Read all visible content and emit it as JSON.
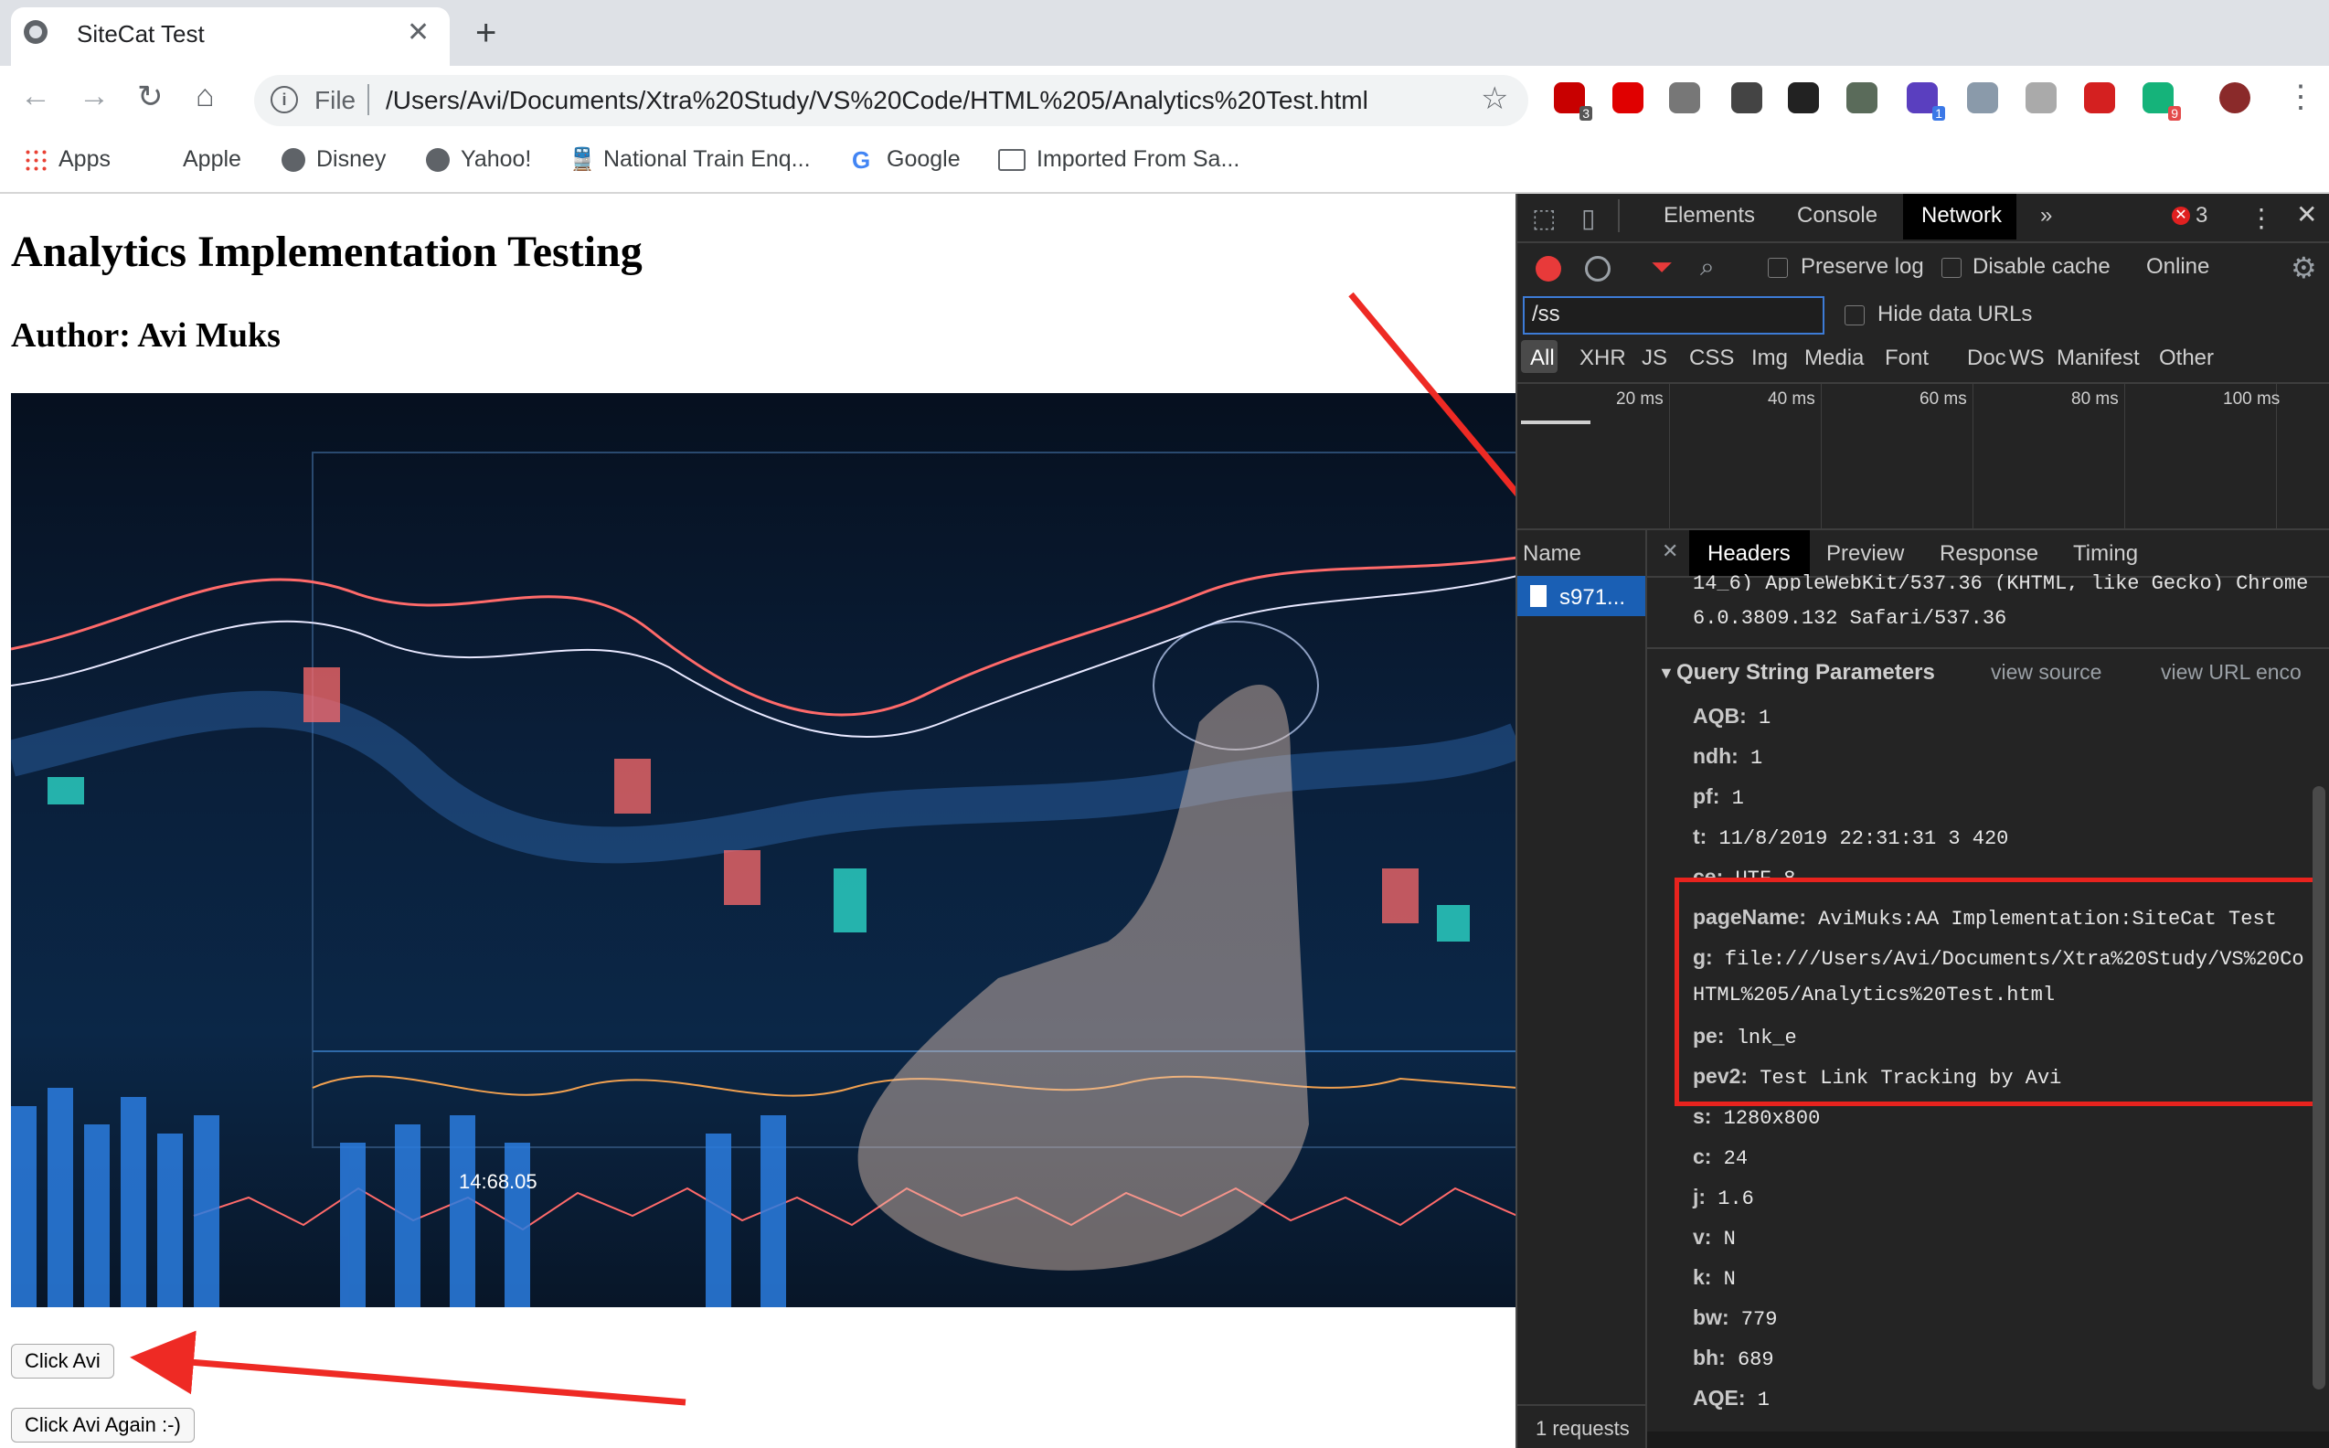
{
  "browser": {
    "tab_title": "SiteCat Test",
    "url_scheme": "File",
    "url": "/Users/Avi/Documents/Xtra%20Study/VS%20Code/HTML%205/Analytics%20Test.html"
  },
  "extensions": [
    {
      "name": "abp-icon",
      "color": "#c80000",
      "badge": "3"
    },
    {
      "name": "ublock-icon",
      "color": "#e00000",
      "badge": ""
    },
    {
      "name": "circle-icon",
      "color": "#777777",
      "badge": ""
    },
    {
      "name": "eye-icon",
      "color": "#444444",
      "badge": ""
    },
    {
      "name": "mask-icon",
      "color": "#222222",
      "badge": ""
    },
    {
      "name": "image-icon",
      "color": "#5a6b5a",
      "badge": ""
    },
    {
      "name": "p-icon",
      "color": "#5a3fbf",
      "badge": "1"
    },
    {
      "name": "w-icon",
      "color": "#8a9aaa",
      "badge": ""
    },
    {
      "name": "translate-icon",
      "color": "#aaaaaa",
      "badge": ""
    },
    {
      "name": "video-icon",
      "color": "#d42020",
      "badge": ""
    },
    {
      "name": "grammarly-icon",
      "color": "#15b37a",
      "badge": "9"
    },
    {
      "name": "profile-avatar",
      "color": "#8a2a2a",
      "badge": ""
    }
  ],
  "bookmarks": [
    "Apps",
    "Apple",
    "Disney",
    "Yahoo!",
    "National Train Enq...",
    "Google",
    "Imported From Sa..."
  ],
  "page": {
    "heading": "Analytics Implementation Testing",
    "author": "Author: Avi Muks",
    "chart_label": "14:68.05",
    "button1": "Click Avi",
    "button2": "Click Avi Again :-)"
  },
  "devtools": {
    "tabs": [
      "Elements",
      "Console",
      "Network"
    ],
    "error_count": "3",
    "preserve_log": "Preserve log",
    "disable_cache": "Disable cache",
    "throttle": "Online",
    "filter_value": "/ss",
    "hide_data_urls": "Hide data URLs",
    "type_filters": [
      "All",
      "XHR",
      "JS",
      "CSS",
      "Img",
      "Media",
      "Font",
      "Doc",
      "WS",
      "Manifest",
      "Other"
    ],
    "timeline_ticks": [
      "20 ms",
      "40 ms",
      "60 ms",
      "80 ms",
      "100 ms"
    ],
    "name_header": "Name",
    "request_name": "s971...",
    "requests_count": "1 requests",
    "detail_tabs": [
      "Headers",
      "Preview",
      "Response",
      "Timing"
    ],
    "ua_line1": "14_6) AppleWebKit/537.36 (KHTML, like Gecko) Chrome",
    "ua_line2": "6.0.3809.132 Safari/537.36",
    "qsp_title": "Query String Parameters",
    "view_source": "view source",
    "view_url": "view URL enco",
    "params": [
      {
        "k": "AQB:",
        "v": "1"
      },
      {
        "k": "ndh:",
        "v": "1"
      },
      {
        "k": "pf:",
        "v": "1"
      },
      {
        "k": "t:",
        "v": "11/8/2019 22:31:31 3 420"
      },
      {
        "k": "ce:",
        "v": "UTF-8"
      },
      {
        "k": "pageName:",
        "v": "AviMuks:AA Implementation:SiteCat Test"
      },
      {
        "k": "g:",
        "v": "file:///Users/Avi/Documents/Xtra%20Study/VS%20Co"
      },
      {
        "k": "",
        "v": "HTML%205/Analytics%20Test.html"
      },
      {
        "k": "pe:",
        "v": "lnk_e"
      },
      {
        "k": "pev2:",
        "v": "Test Link Tracking by Avi"
      },
      {
        "k": "s:",
        "v": "1280x800"
      },
      {
        "k": "c:",
        "v": "24"
      },
      {
        "k": "j:",
        "v": "1.6"
      },
      {
        "k": "v:",
        "v": "N"
      },
      {
        "k": "k:",
        "v": "N"
      },
      {
        "k": "bw:",
        "v": "779"
      },
      {
        "k": "bh:",
        "v": "689"
      },
      {
        "k": "AQE:",
        "v": "1"
      }
    ]
  }
}
